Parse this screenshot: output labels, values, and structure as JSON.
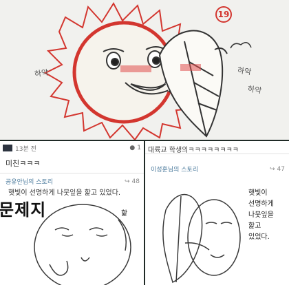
{
  "top_panel": {
    "page_number": "19",
    "sfx_left": "하악",
    "sfx_right_1": "하악",
    "sfx_right_2": "하악"
  },
  "left_post": {
    "timestamp": "13분 전",
    "comment_count": "1",
    "title": "미친ㅋㅋㅋ",
    "source": "공유안님의 스토리",
    "share_count": "48",
    "body": "햇빛이 선명하게 나뭇잎을 핥고 있었다.",
    "comic_title": "문제지",
    "comic_note": "핥"
  },
  "right_post": {
    "top_text": "대륙교 학생의ㅋㅋㅋㅋㅋㅋㅋㅋ",
    "source": "이성훈님의 스토리",
    "share_count": "47",
    "handwritten_lines": [
      "햇빛이",
      "선명하게",
      "나뭇잎을",
      "핥고",
      "있었다."
    ]
  },
  "colors": {
    "sun_red": "#d3362f",
    "pencil": "#3a3a3a",
    "link_blue": "#4a7a9c"
  },
  "icons": [
    "comment-icon",
    "share-icon"
  ]
}
